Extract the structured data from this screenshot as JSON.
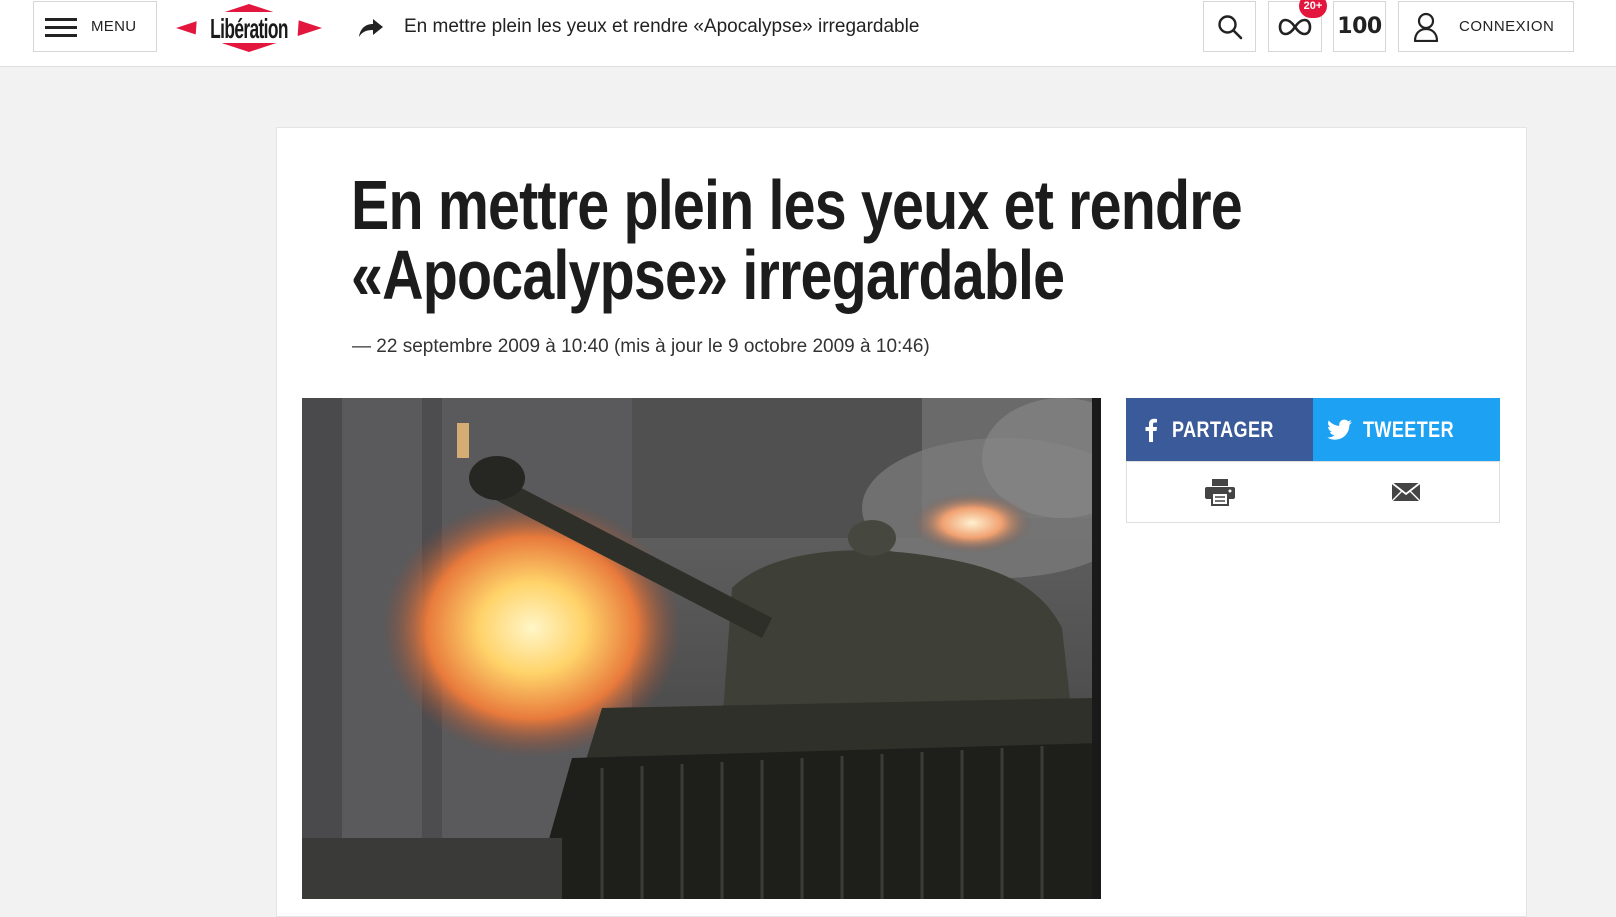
{
  "header": {
    "menu_label": "MENU",
    "logo_text": "Libération",
    "article_title": "En mettre plein les yeux et rendre «Apocalypse» irregardable",
    "badge": "20+",
    "hundred": "100",
    "login_label": "CONNEXION"
  },
  "article": {
    "title": "En mettre plein les yeux et rendre «Apocalypse» irregardable",
    "date": "— 22 septembre 2009 à 10:40 (mis à jour le 9 octobre 2009 à 10:46)"
  },
  "share": {
    "facebook_label": "PARTAGER",
    "twitter_label": "TWEETER"
  },
  "colors": {
    "brand_red": "#e3173e",
    "facebook": "#3b5a9a",
    "twitter": "#1da1f2"
  }
}
